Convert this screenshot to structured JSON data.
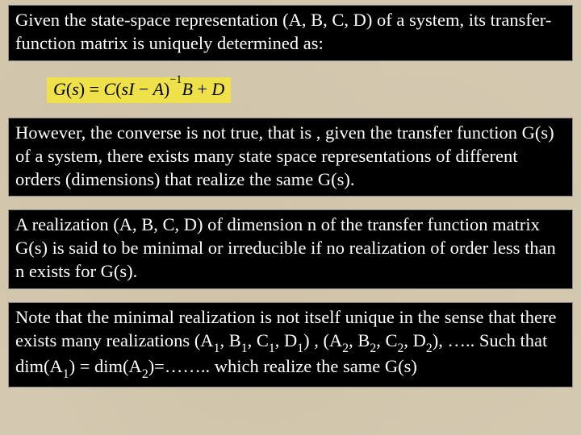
{
  "block1": {
    "text": "Given the state-space representation (A, B, C, D) of a system, its transfer-function matrix is uniquely determined as:"
  },
  "formula": {
    "expr": "G(s) = C(sI − A)⁻¹B + D"
  },
  "block2": {
    "text": "However, the converse is not true, that is , given the transfer function G(s) of a system, there exists many state space representations of different orders (dimensions) that realize the same G(s)."
  },
  "block3": {
    "text": "A realization (A, B, C, D) of dimension n of the transfer function matrix G(s) is said to be minimal or irreducible if no realization of order less than n exists for G(s)."
  },
  "block4": {
    "line1": "Note that the minimal realization is not itself unique in the sense that there exists many realizations (A",
    "a1": "1",
    "mid1": ", B",
    "b1": "1",
    "mid2": ", C",
    "c1": "1",
    "mid3": ", D",
    "d1": "1",
    "mid4": ") , (A",
    "a2": "2",
    "mid5": ", B",
    "b2": "2",
    "mid6": ", C",
    "c2": "2",
    "mid7": ", D",
    "d2": "2",
    "mid8": "), ….. Such that dim(A",
    "da1": "1",
    "mid9": ") = dim(A",
    "da2": "2",
    "tail": ")=…….. which realize the same G(s)"
  }
}
